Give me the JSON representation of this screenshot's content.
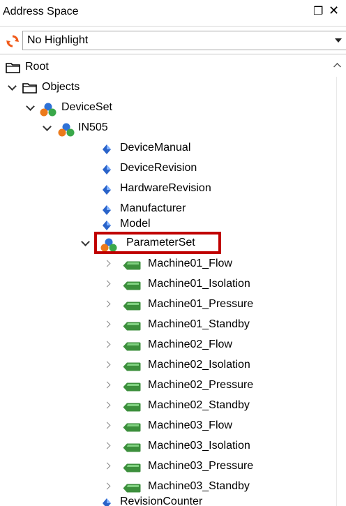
{
  "panel": {
    "title": "Address Space",
    "float_glyph": "Թ",
    "close_glyph": "✕"
  },
  "toolbar": {
    "refresh_icon": "refresh-icon",
    "highlight_selected": "No Highlight"
  },
  "colors": {
    "highlight_border": "#c00000",
    "variable_icon": "#3c8f3c",
    "property_icon": "#2a63c9",
    "folder_icon": "#d9a400"
  },
  "tree": {
    "root": "Root",
    "objects": "Objects",
    "device_set": "DeviceSet",
    "device": "IN505",
    "properties": [
      "DeviceManual",
      "DeviceRevision",
      "HardwareRevision",
      "Manufacturer",
      "Model"
    ],
    "parameter_set": "ParameterSet",
    "parameters": [
      "Machine01_Flow",
      "Machine01_Isolation",
      "Machine01_Pressure",
      "Machine01_Standby",
      "Machine02_Flow",
      "Machine02_Isolation",
      "Machine02_Pressure",
      "Machine02_Standby",
      "Machine03_Flow",
      "Machine03_Isolation",
      "Machine03_Pressure",
      "Machine03_Standby"
    ],
    "trailing": "RevisionCounter"
  }
}
